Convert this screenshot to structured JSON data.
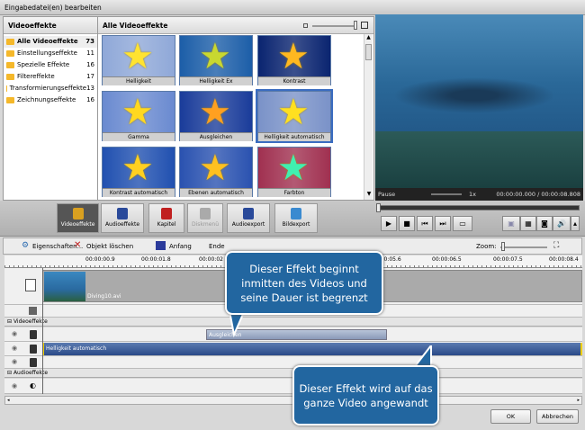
{
  "window": {
    "title": "Eingabedatei(en) bearbeiten"
  },
  "categories": {
    "header": "Videoeffekte",
    "items": [
      {
        "label": "Alle Videoeffekte",
        "count": "73"
      },
      {
        "label": "Einstellungseffekte",
        "count": "11"
      },
      {
        "label": "Spezielle Effekte",
        "count": "16"
      },
      {
        "label": "Filtereffekte",
        "count": "17"
      },
      {
        "label": "Transformierungseffekte",
        "count": "13"
      },
      {
        "label": "Zeichnungseffekte",
        "count": "16"
      }
    ]
  },
  "gallery": {
    "header": "Alle Videoeffekte",
    "items": [
      {
        "label": "Helligkeit",
        "bg": "#8fa8d8",
        "star": "#ffe330"
      },
      {
        "label": "Helligkeit Ex",
        "bg": "#1c5ea8",
        "star": "#c8d830"
      },
      {
        "label": "Kontrast",
        "bg": "#0a2470",
        "star": "#ffb820"
      },
      {
        "label": "Gamma",
        "bg": "#6a8ad0",
        "star": "#ffd820"
      },
      {
        "label": "Ausgleichen",
        "bg": "#1a3c9a",
        "star": "#ffa020"
      },
      {
        "label": "Helligkeit automatisch",
        "bg": "#7a92c8",
        "star": "#ffe020"
      },
      {
        "label": "Kontrast automatisch",
        "bg": "#2050b0",
        "star": "#ffd020"
      },
      {
        "label": "Ebenen automatisch",
        "bg": "#2a52b0",
        "star": "#ffc020"
      },
      {
        "label": "Farbton",
        "bg": "#a03050",
        "star": "#40f0b0"
      }
    ]
  },
  "player": {
    "status": "Pause",
    "speed": "1x",
    "time": "00:00:00.000 / 00:00:08.808"
  },
  "toolbar": {
    "items": [
      "Videoeffekte",
      "Audioeffekte",
      "Kapitel",
      "Diskmenü",
      "Audioexport",
      "Bildexport"
    ]
  },
  "timeline": {
    "properties": "Eigenschaften...",
    "delete": "Objekt löschen",
    "start": "Anfang",
    "end": "Ende",
    "zoom": "Zoom:",
    "ruler": [
      "00:00:00.9",
      "00:00:01.8",
      "00:00:02",
      "00:00:05.6",
      "00:00:06.5",
      "00:00:07.5",
      "00:00:08.4"
    ],
    "clip": "Diving10.avi",
    "video_section": "Videoeffekte",
    "audio_section": "Audioeffekte",
    "effect1": "Ausgleichen",
    "effect2": "Helligkeit automatisch"
  },
  "callouts": {
    "first": "Dieser Effekt beginnt inmitten des Videos und seine Dauer ist begrenzt",
    "second": "Dieser Effekt wird auf das ganze Video angewandt"
  },
  "buttons": {
    "ok": "OK",
    "cancel": "Abbrechen"
  }
}
